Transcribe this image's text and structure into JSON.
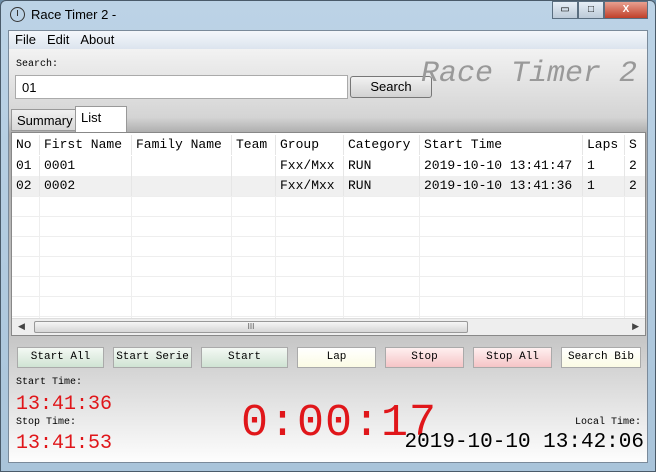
{
  "window": {
    "title": "Race Timer 2 -",
    "min": "▭",
    "max": "□",
    "close": "X"
  },
  "menu": [
    "File",
    "Edit",
    "About"
  ],
  "search": {
    "label": "Search:",
    "value": "01",
    "button": "Search"
  },
  "logo": "Race Timer 2",
  "tabs": [
    "Summary",
    "List"
  ],
  "table": {
    "columns": [
      "No",
      "First Name",
      "Family Name",
      "Team",
      "Group",
      "Category",
      "Start Time",
      "Laps",
      "S"
    ],
    "rows": [
      [
        "01",
        "0001",
        "",
        "",
        "Fxx/Mxx",
        "RUN",
        "2019-10-10 13:41:47",
        "1",
        "2"
      ],
      [
        "02",
        "0002",
        "",
        "",
        "Fxx/Mxx",
        "RUN",
        "2019-10-10 13:41:36",
        "1",
        "2"
      ]
    ],
    "scroll_thumb": "III"
  },
  "buttons": [
    "Start All",
    "Start Serie",
    "Start",
    "Lap",
    "Stop",
    "Stop All",
    "Search Bib"
  ],
  "times": {
    "start_label": "Start Time:",
    "start_value": "13:41:36",
    "stop_label": "Stop Time:",
    "stop_value": "13:41:53",
    "elapsed": "0:00:17",
    "local_label": "Local Time:",
    "local_value": "2019-10-10 13:42:06"
  },
  "colors": {
    "accent_red": "#e0161a"
  }
}
